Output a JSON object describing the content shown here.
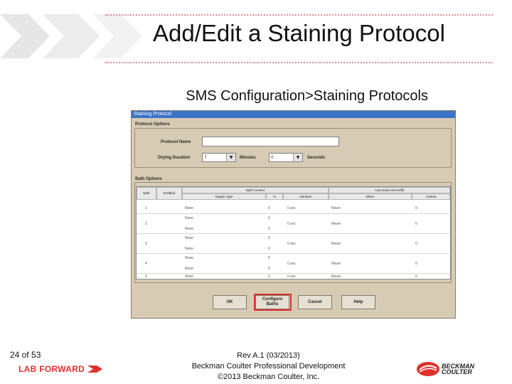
{
  "slide": {
    "title": "Add/Edit a Staining Protocol",
    "subtitle": "SMS Configuration>Staining Protocols",
    "page": "24 of 53",
    "brand_left": "LAB FORWARD",
    "footer_lines": [
      "Rev A.1 (03/2013)",
      "Beckman Coulter Professional Development",
      "©2013 Beckman Coulter, Inc."
    ],
    "logo_text": "BECKMAN COULTER"
  },
  "window": {
    "title": "Staining Protocol",
    "protocol_options": {
      "section_label": "Protocol Options",
      "name_label": "Protocol Name",
      "name_value": "",
      "drying_label": "Drying Duration",
      "minutes_value": "7",
      "minutes_label": "Minutes",
      "seconds_value": "0",
      "seconds_label": "Seconds"
    },
    "bath_options": {
      "section_label": "Bath Options",
      "headers": {
        "bath": "Bath",
        "enabled": "Enabled",
        "bath_content": "Bath Content",
        "supply_type": "Supply Type",
        "percent": "%",
        "duration": "Duration",
        "auto_drain": "Auto Drain and Refill",
        "when": "When",
        "criteria": "Criteria"
      },
      "rows": [
        {
          "bath": "1",
          "supplies": [
            "None"
          ],
          "percents": [
            "0"
          ],
          "duration": "0 sec",
          "when": "Never",
          "criteria": "0"
        },
        {
          "bath": "2",
          "supplies": [
            "None",
            "None"
          ],
          "percents": [
            "0",
            "0"
          ],
          "duration": "0 sec",
          "when": "Never",
          "criteria": "0"
        },
        {
          "bath": "3",
          "supplies": [
            "None",
            "None"
          ],
          "percents": [
            "0",
            "0"
          ],
          "duration": "0 sec",
          "when": "Never",
          "criteria": "0"
        },
        {
          "bath": "4",
          "supplies": [
            "None",
            "None"
          ],
          "percents": [
            "0",
            "0"
          ],
          "duration": "0 sec",
          "when": "Never",
          "criteria": "0"
        },
        {
          "bath": "5",
          "supplies": [
            "None"
          ],
          "percents": [
            "0"
          ],
          "duration": "0 sec",
          "when": "Never",
          "criteria": "0"
        }
      ]
    },
    "buttons": {
      "ok": "OK",
      "configure_baths": "Configure Baths",
      "cancel": "Cancel",
      "help": "Help"
    }
  },
  "colors": {
    "accent_red": "#e0302c",
    "dialog_bg": "#d8cbb4",
    "titlebar_blue": "#3b74c8"
  },
  "icons": [
    "dropdown-arrow-icon",
    "chevron-arrow-icon",
    "beckman-coulter-logo"
  ]
}
